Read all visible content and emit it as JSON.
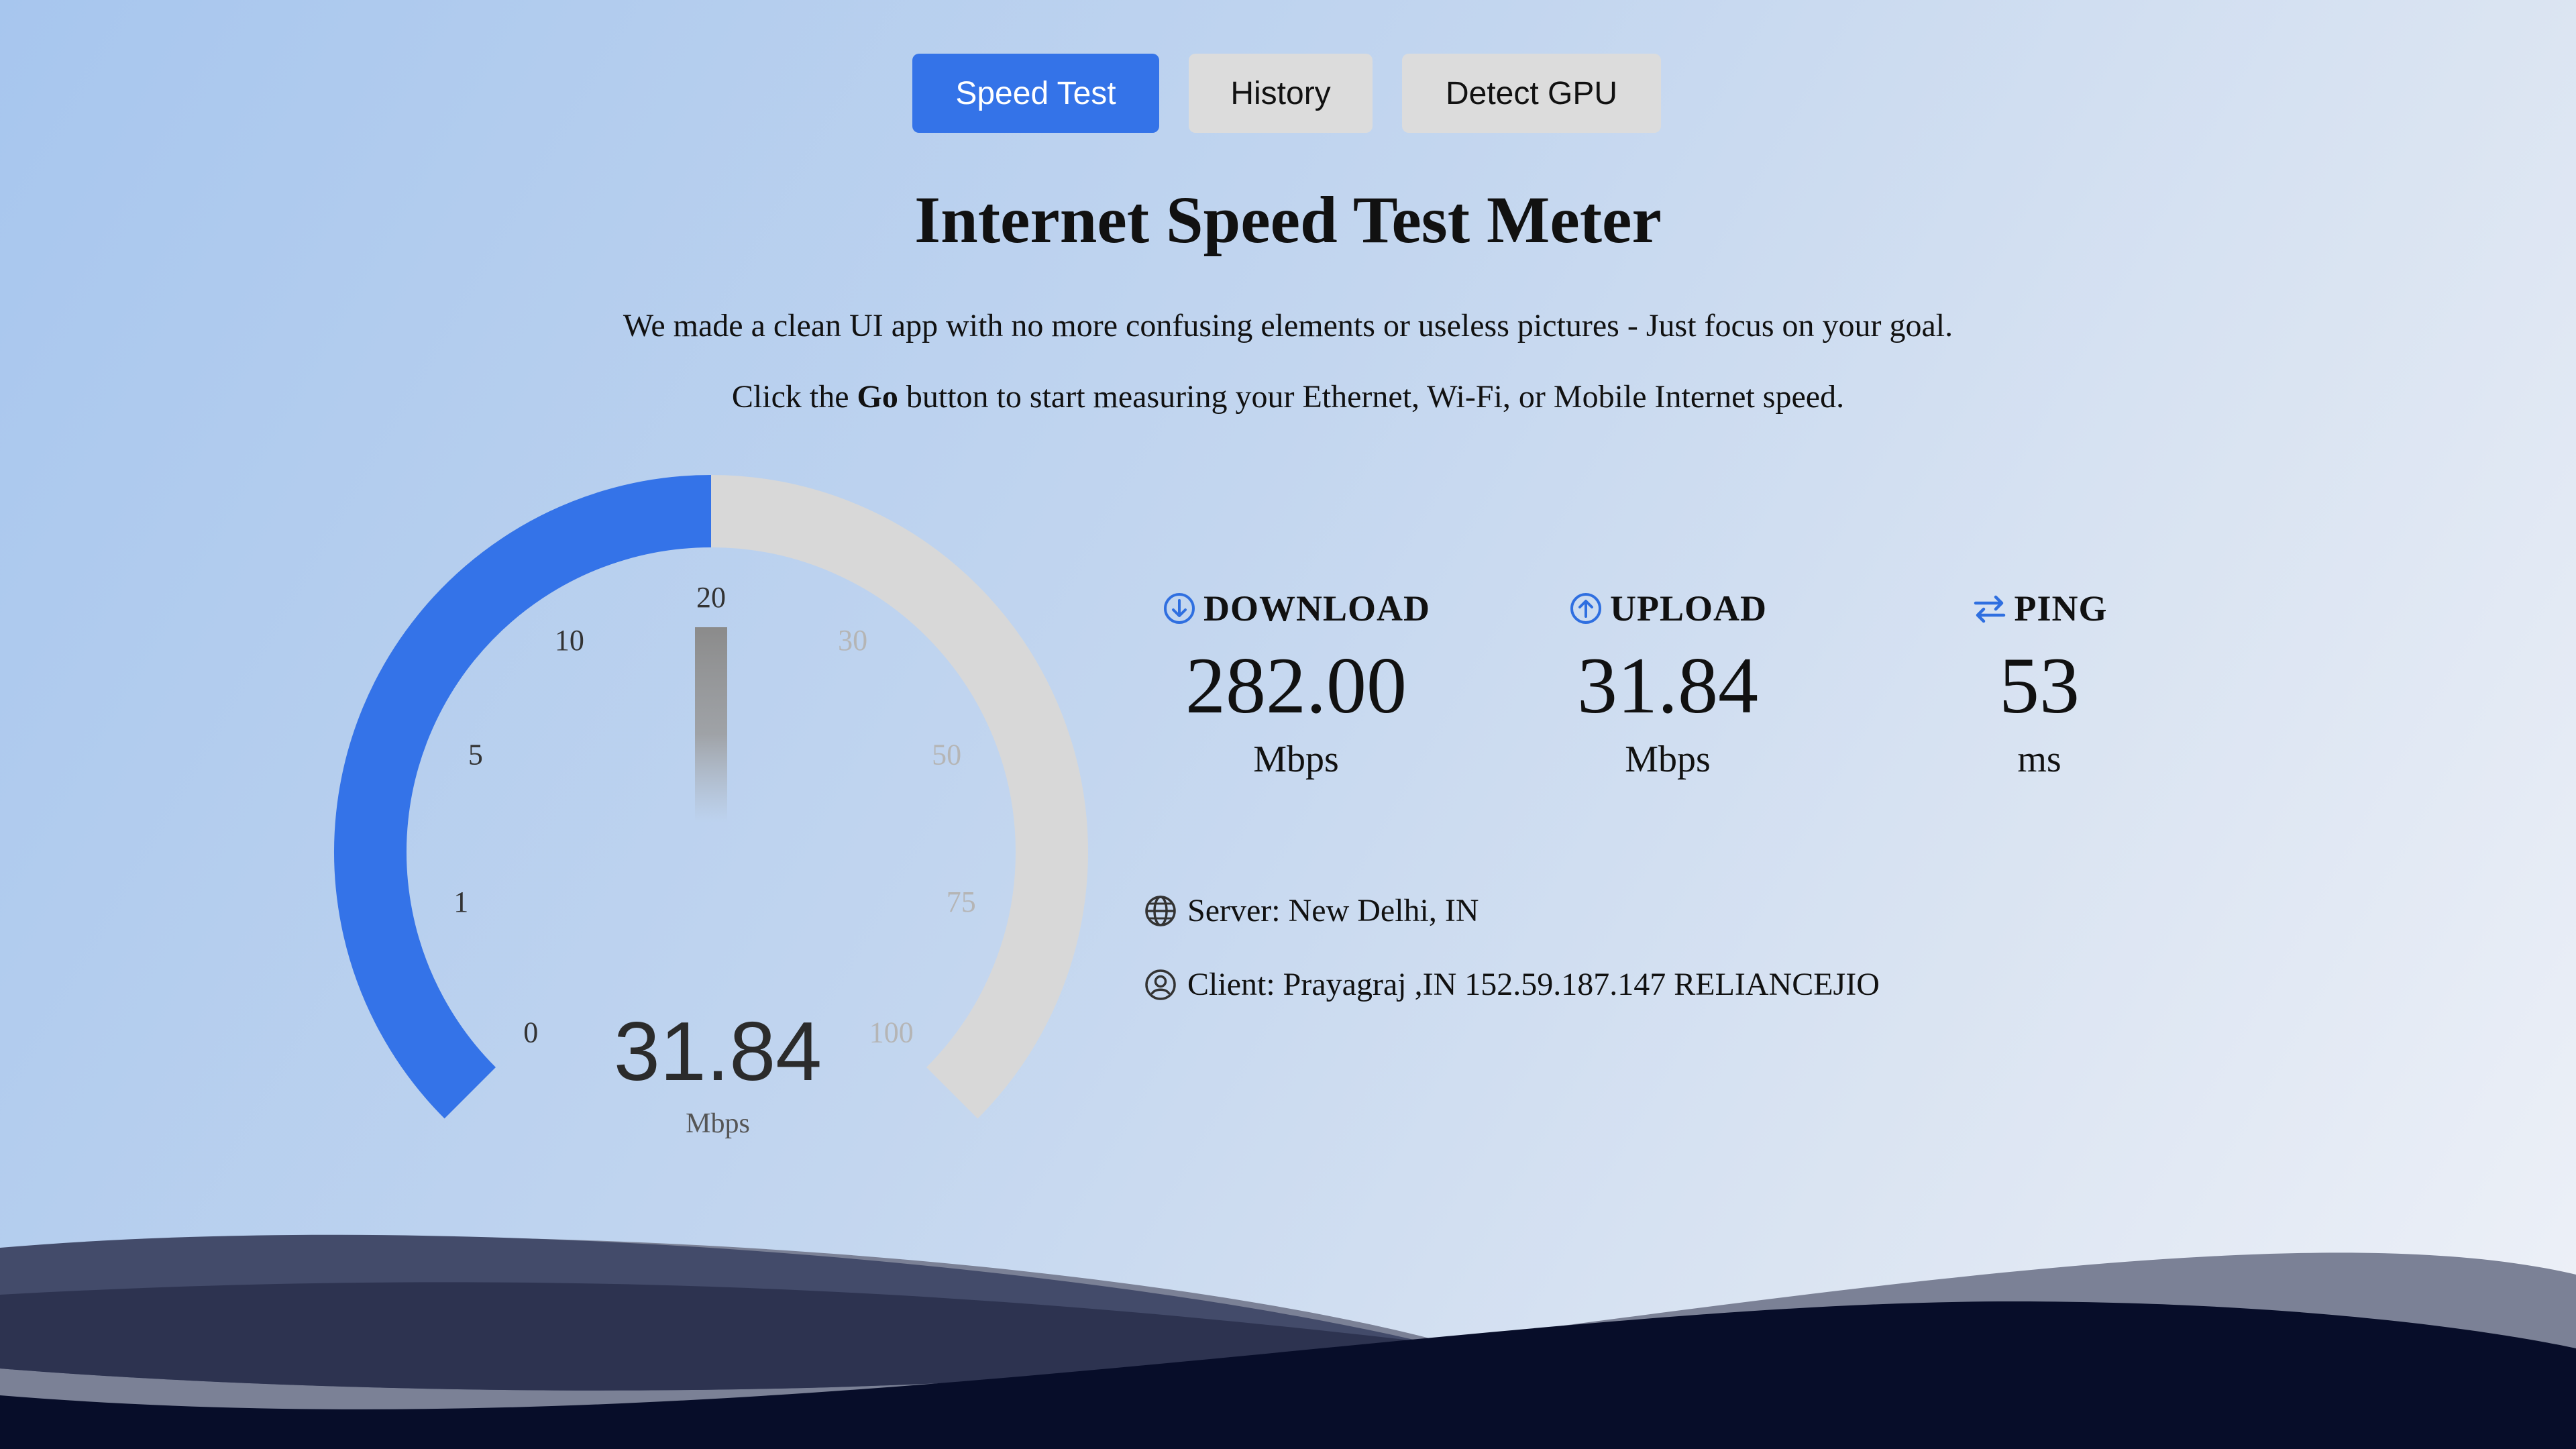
{
  "nav": {
    "speed_test": "Speed Test",
    "history": "History",
    "detect_gpu": "Detect GPU"
  },
  "header": {
    "title": "Internet Speed Test Meter",
    "description_line1": "We made a clean UI app with no more confusing elements or useless pictures - Just focus on your goal.",
    "description_line2_before": "Click the ",
    "description_line2_bold": "Go",
    "description_line2_after": " button to start measuring your Ethernet, Wi-Fi, or Mobile Internet speed."
  },
  "gauge": {
    "value": "31.84",
    "unit": "Mbps",
    "scale_labels": [
      "0",
      "1",
      "5",
      "10",
      "20",
      "30",
      "50",
      "75",
      "100"
    ],
    "progress_fraction": 0.5,
    "needle_fraction": 0.5,
    "colors": {
      "progress": "#3473e8",
      "track": "#d8d8d8"
    }
  },
  "stats": {
    "download": {
      "label": "DOWNLOAD",
      "value": "282.00",
      "unit": "Mbps",
      "icon": "download-circle-icon"
    },
    "upload": {
      "label": "UPLOAD",
      "value": "31.84",
      "unit": "Mbps",
      "icon": "upload-circle-icon"
    },
    "ping": {
      "label": "PING",
      "value": "53",
      "unit": "ms",
      "icon": "swap-arrows-icon"
    }
  },
  "info": {
    "server": "Server: New Delhi, IN",
    "client": "Client: Prayagraj ,IN 152.59.187.147 RELIANCEJIO"
  },
  "colors": {
    "accent": "#3473e8",
    "button_inactive": "#dcdcdc",
    "wave_dark": "#070d29",
    "wave_mid": "#2d3350"
  }
}
